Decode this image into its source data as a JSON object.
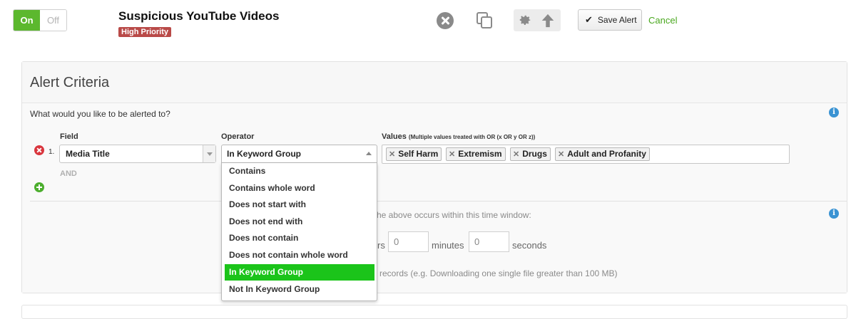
{
  "toggle": {
    "on_label": "On",
    "off_label": "Off"
  },
  "alert": {
    "title": "Suspicious YouTube Videos",
    "priority": "High Priority"
  },
  "toolbar": {
    "save_label": "Save Alert",
    "cancel_label": "Cancel",
    "accent_color": "#5cb82e"
  },
  "criteria": {
    "title": "Alert Criteria",
    "question": "What would you like to be alerted to?",
    "field_label": "Field",
    "operator_label": "Operator",
    "values_label": "Values",
    "values_hint": "(Multiple values treated with OR (x OR y OR z))",
    "rows": [
      {
        "number": "1.",
        "field": "Media Title",
        "operator": "In Keyword Group",
        "values": [
          "Self Harm",
          "Extremism",
          "Drugs",
          "Adult and Profanity"
        ]
      }
    ],
    "and_label": "AND"
  },
  "operator_options": [
    "Contains",
    "Contains whole word",
    "Does not start with",
    "Does not end with",
    "Does not contain",
    "Does not contain whole word",
    "In Keyword Group",
    "Not In Keyword Group"
  ],
  "selected_operator_index": 6,
  "time_window": {
    "text": "he above occurs within this time window:",
    "hours_suffix": "rs",
    "minutes_value": "0",
    "minutes_label": "minutes",
    "seconds_value": "0",
    "seconds_label": "seconds"
  },
  "records_text": "records (e.g. Downloading one single file greater than 100 MB)",
  "icons": [
    "close-circle-icon",
    "copy-icon",
    "gear-icon",
    "arrow-up-icon",
    "check-icon",
    "info-icon",
    "remove-icon",
    "add-icon",
    "tag-remove-icon",
    "chevron-down-icon",
    "chevron-up-icon"
  ]
}
